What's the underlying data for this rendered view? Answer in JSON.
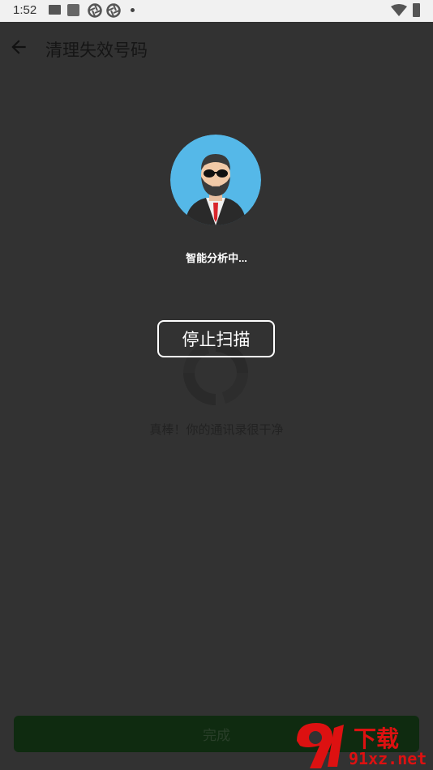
{
  "status_bar": {
    "time": "1:52",
    "icons": [
      "mail-icon",
      "square-icon",
      "aperture-icon",
      "aperture-icon",
      "dot-icon",
      "wifi-icon",
      "battery-icon"
    ]
  },
  "app_bar": {
    "title": "清理失效号码"
  },
  "empty_state": {
    "message": "真棒！你的通讯录很干净"
  },
  "scan_overlay": {
    "status_text": "智能分析中...",
    "stop_label": "停止扫描"
  },
  "footer": {
    "done_label": "完成"
  },
  "watermark": {
    "line1": "下载",
    "line2": "91xz.net"
  },
  "colors": {
    "overlay_bg": "#323232",
    "accent_green": "#0f2b10",
    "avatar_bg": "#55b8e8",
    "watermark_red": "#dd1111"
  }
}
